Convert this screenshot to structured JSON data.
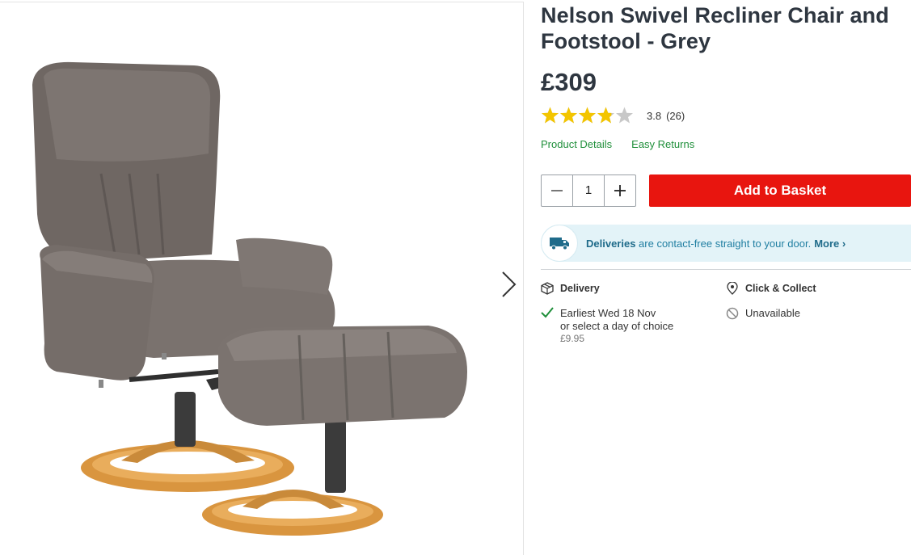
{
  "product": {
    "title": "Nelson Swivel Recliner Chair and Footstool - Grey",
    "price": "£309",
    "rating_value": "3.8",
    "rating_count": "(26)",
    "rating_stars": 3.8,
    "star_color": "#f3c500"
  },
  "links": {
    "details": "Product Details",
    "returns": "Easy Returns"
  },
  "purchase": {
    "quantity": "1",
    "add_label": "Add to Basket",
    "button_color": "#e8150f"
  },
  "banner": {
    "strong": "Deliveries",
    "text": " are contact-free straight to your door.",
    "more": "More"
  },
  "delivery": {
    "heading": "Delivery",
    "line1": "Earliest Wed 18 Nov",
    "line2": "or select a day of choice",
    "fee": "£9.95"
  },
  "collect": {
    "heading": "Click & Collect",
    "status": "Unavailable"
  },
  "icons": {
    "next": "chevron-right-icon",
    "minus": "minus-icon",
    "plus": "plus-icon",
    "truck": "truck-icon",
    "box": "box-icon",
    "pin": "location-pin-icon",
    "check": "check-icon",
    "unavailable": "unavailable-icon"
  }
}
